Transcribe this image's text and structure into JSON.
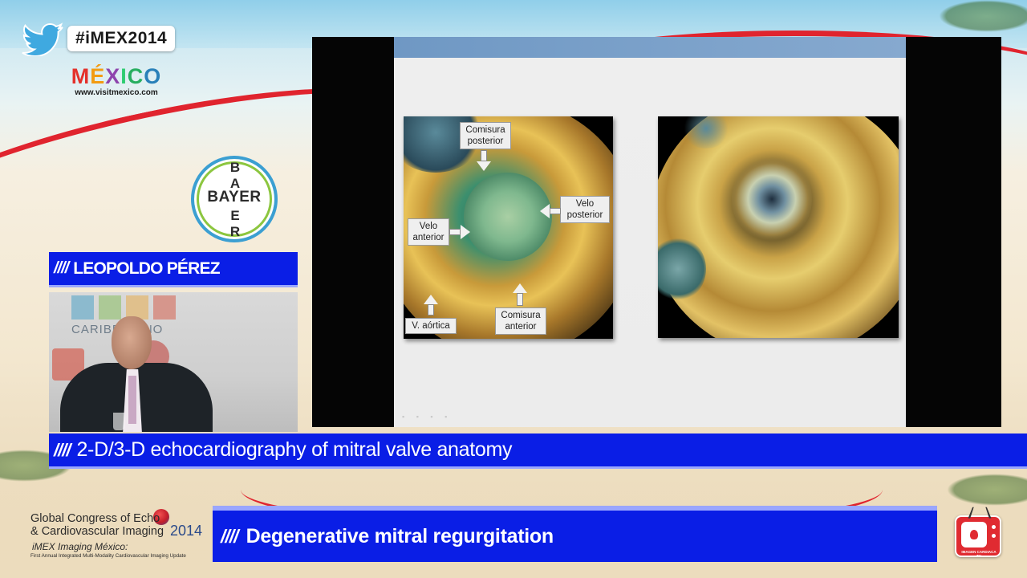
{
  "brand": {
    "hashtag": "#iMEX2014",
    "mexico_letters": [
      "M",
      "É",
      "X",
      "I",
      "C",
      "O"
    ],
    "mexico_colors": [
      "#e4312b",
      "#f39c12",
      "#8e44ad",
      "#2ecc71",
      "#27ae60",
      "#2980b9"
    ],
    "mexico_url": "www.visitmexico.com",
    "sponsor_h": "BAYER",
    "sponsor_v": [
      "B",
      "A",
      "",
      "E",
      "R"
    ]
  },
  "speaker": {
    "name": "LEOPOLDO PÉREZ",
    "slashes": "////",
    "backdrop_text": "CARIBE    CANO"
  },
  "slide": {
    "labels": {
      "comisura_posterior": "Comisura posterior",
      "velo_posterior": "Velo posterior",
      "velo_anterior": "Velo anterior",
      "v_aortica": "V. aórtica",
      "comisura_anterior": "Comisura anterior"
    }
  },
  "topic": {
    "slashes": "////",
    "text": "2-D/3-D echocardiography of mitral valve anatomy"
  },
  "session": {
    "slashes": "////",
    "text": "Degenerative mitral regurgitation"
  },
  "congress": {
    "line1": "Global Congress of Echo",
    "line2": "& Cardiovascular Imaging",
    "year": "2014",
    "line3": "iMEX Imaging México:",
    "line4": "First Annual Integrated Multi-Modality Cardiovascular Imaging Update"
  },
  "tv_logo": {
    "caption": "IMAGEN CARDIACA TV"
  },
  "colors": {
    "bar_blue": "#0a1ee6",
    "bar_edge": "#9aa6ff",
    "accent_red": "#e0242e"
  }
}
